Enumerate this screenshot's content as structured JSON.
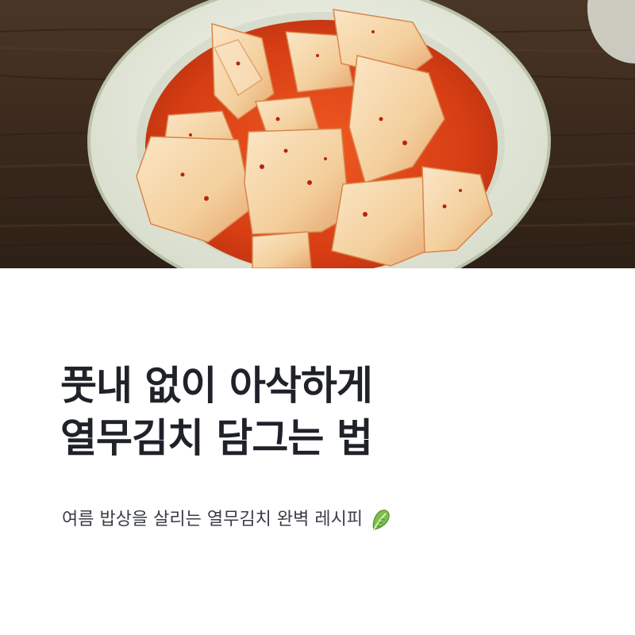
{
  "hero": {
    "image_alt": "radish-kimchi-bowl-photo"
  },
  "title": {
    "line1": "풋내 없이 아삭하게",
    "line2": "열무김치 담그는 법"
  },
  "subtitle": {
    "text": "여름 밥상을 살리는 열무김치 완벽 레시피",
    "emoji_icon": "leafy-green-icon"
  },
  "colors": {
    "title": "#1f2229",
    "subtitle": "#3a3d44",
    "table_wood": "#3b2a1f",
    "bowl": "#eef1e6",
    "sauce": "#e0451d",
    "radish": "#f6dcb6"
  }
}
